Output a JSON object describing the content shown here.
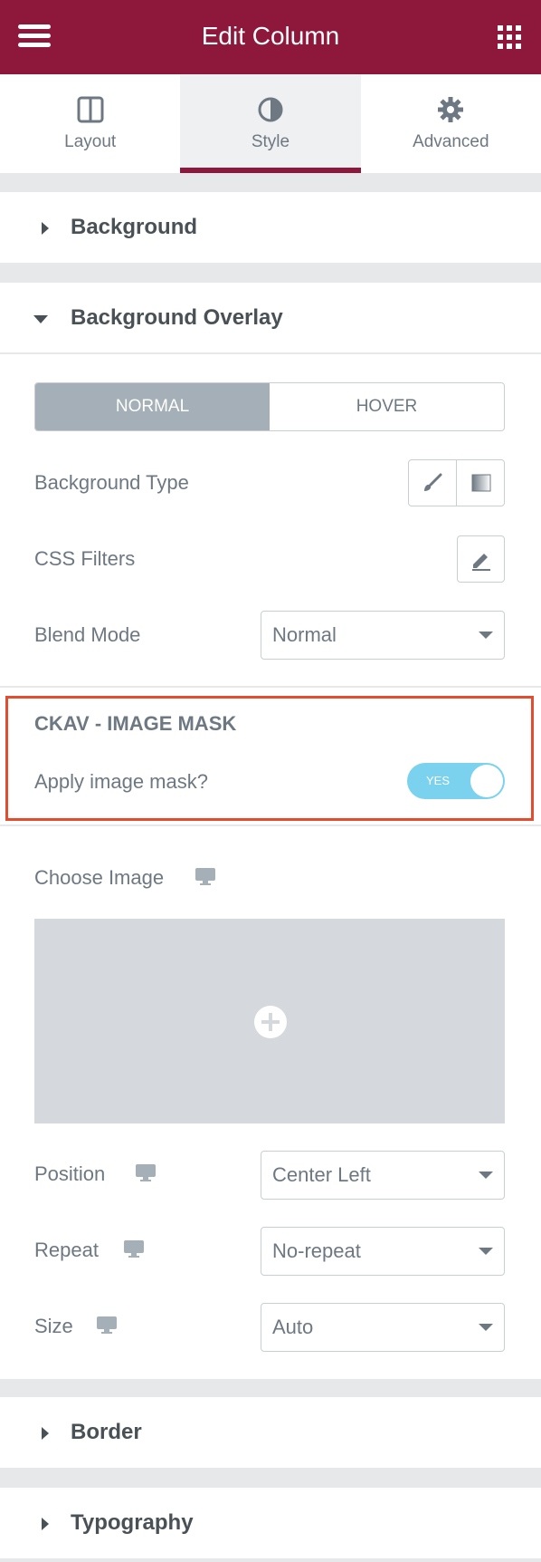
{
  "header": {
    "title": "Edit Column",
    "menu_icon": "hamburger-icon",
    "apps_icon": "grid-icon"
  },
  "tabs": [
    {
      "label": "Layout",
      "icon": "layout-icon"
    },
    {
      "label": "Style",
      "icon": "contrast-icon",
      "active": true
    },
    {
      "label": "Advanced",
      "icon": "gear-icon"
    }
  ],
  "sections": {
    "background": "Background",
    "background_overlay": "Background Overlay",
    "border": "Border",
    "typography": "Typography"
  },
  "overlay": {
    "state_tabs": [
      "NORMAL",
      "HOVER"
    ],
    "background_type_label": "Background Type",
    "css_filters_label": "CSS Filters",
    "blend_mode_label": "Blend Mode",
    "blend_mode_value": "Normal"
  },
  "mask": {
    "heading": "CKAV - IMAGE MASK",
    "apply_label": "Apply image mask?",
    "toggle_text": "YES",
    "toggle_on": true,
    "choose_image_label": "Choose Image",
    "position_label": "Position",
    "position_value": "Center Left",
    "repeat_label": "Repeat",
    "repeat_value": "No-repeat",
    "size_label": "Size",
    "size_value": "Auto"
  },
  "colors": {
    "brand": "#8e183c",
    "toggle": "#7ad2ee",
    "highlight": "#e34d2f",
    "active_state": "#a4afb7"
  }
}
